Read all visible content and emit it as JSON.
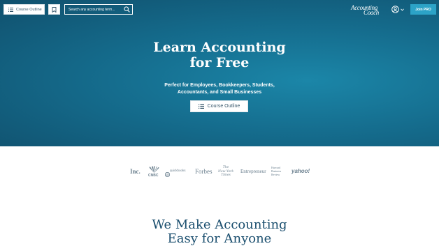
{
  "header": {
    "course_outline_label": "Course Outline",
    "search_placeholder": "Search any accounting term...",
    "logo_line1": "Accounting",
    "logo_line2": "Coach",
    "join_label": "Join PRO"
  },
  "hero": {
    "title_line1": "Learn Accounting",
    "title_line2": "for Free",
    "subtitle_line1": "Perfect for Employees, Bookkeepers, Students,",
    "subtitle_line2": "Accountants, and Small Businesses",
    "course_outline_label": "Course Outline"
  },
  "press_logos": {
    "inc": "Inc.",
    "cnbc": "CNBC",
    "quickbooks": "quickbooks",
    "forbes": "Forbes",
    "nyt_1": "The",
    "nyt_2": "New York",
    "nyt_3": "Times",
    "entrepreneur": "Entrepreneur",
    "hbr_1": "Harvard",
    "hbr_2": "Business",
    "hbr_3": "Review",
    "yahoo": "yahoo!"
  },
  "mission": {
    "line1": "We Make Accounting",
    "line2": "Easy for Anyone"
  },
  "colors": {
    "hero_dark": "#10506d",
    "hero_light": "#1b86a8",
    "accent": "#2ca3c7",
    "heading": "#1a4e6e"
  }
}
